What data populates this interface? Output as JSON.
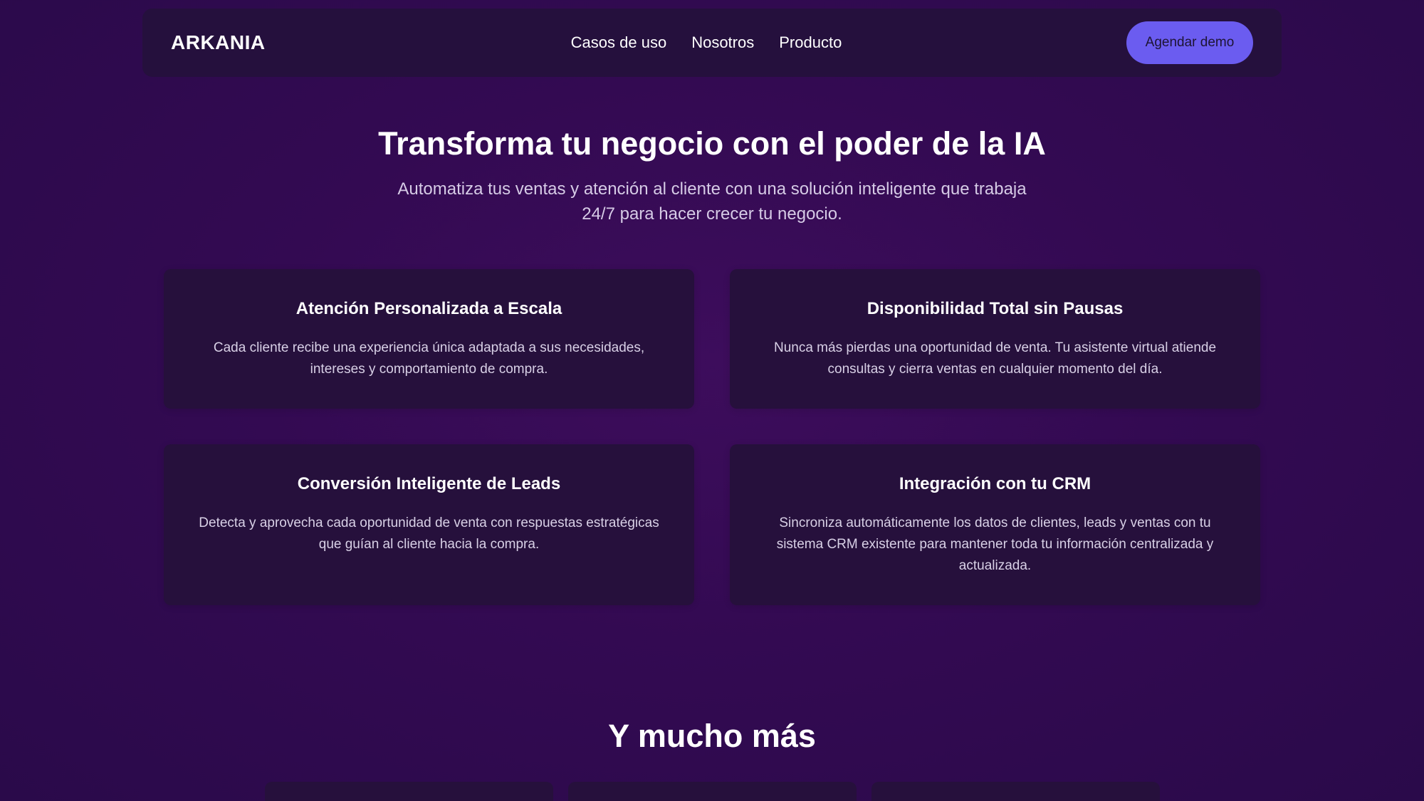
{
  "nav": {
    "brand": "ARKANIA",
    "links": [
      "Casos de uso",
      "Nosotros",
      "Producto"
    ],
    "cta_label": "Agendar demo"
  },
  "hero": {
    "title": "Transforma tu negocio con el poder de la IA",
    "subtitle": "Automatiza tus ventas y atención al cliente con una solución inteligente que trabaja 24/7 para hacer crecer tu negocio."
  },
  "features": [
    {
      "title": "Atención Personalizada a Escala",
      "description": "Cada cliente recibe una experiencia única adaptada a sus necesidades, intereses y comportamiento de compra."
    },
    {
      "title": "Disponibilidad Total sin Pausas",
      "description": "Nunca más pierdas una oportunidad de venta. Tu asistente virtual atiende consultas y cierra ventas en cualquier momento del día."
    },
    {
      "title": "Conversión Inteligente de Leads",
      "description": "Detecta y aprovecha cada oportunidad de venta con respuestas estratégicas que guían al cliente hacia la compra."
    },
    {
      "title": "Integración con tu CRM",
      "description": "Sincroniza automáticamente los datos de clientes, leads y ventas con tu sistema CRM existente para mantener toda tu información centralizada y actualizada."
    }
  ],
  "more": {
    "title": "Y mucho más"
  },
  "colors": {
    "background": "#330a52",
    "surface": "#26103c",
    "accent": "#6b5cf0"
  }
}
